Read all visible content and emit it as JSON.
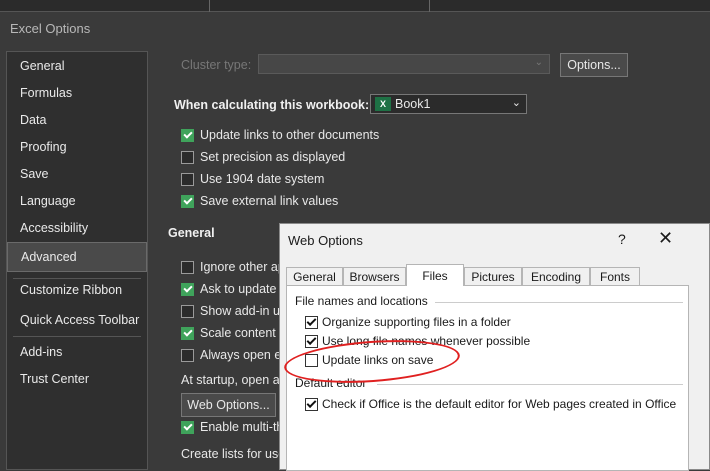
{
  "window": {
    "title": "Excel Options"
  },
  "sidebar": {
    "items": [
      {
        "label": "General"
      },
      {
        "label": "Formulas"
      },
      {
        "label": "Data"
      },
      {
        "label": "Proofing"
      },
      {
        "label": "Save"
      },
      {
        "label": "Language"
      },
      {
        "label": "Accessibility"
      },
      {
        "label": "Advanced",
        "active": true
      },
      {
        "label": "Customize Ribbon"
      },
      {
        "label": "Quick Access Toolbar"
      },
      {
        "label": "Add-ins"
      },
      {
        "label": "Trust Center"
      }
    ]
  },
  "main": {
    "cluster_type_label": "Cluster type:",
    "options_button": "Options...",
    "calc_heading": "When calculating this workbook:",
    "workbook_select": "Book1",
    "calc_options": [
      {
        "label": "Update links to other documents",
        "checked": true
      },
      {
        "label": "Set precision as displayed",
        "checked": false
      },
      {
        "label": "Use 1904 date system",
        "checked": false
      },
      {
        "label": "Save external link values",
        "checked": true
      }
    ],
    "general_heading": "General",
    "general_options": [
      {
        "label": "Ignore other ap",
        "checked": false
      },
      {
        "label": "Ask to update a",
        "checked": true
      },
      {
        "label": "Show add-in us",
        "checked": false
      },
      {
        "label": "Scale content f",
        "checked": true
      },
      {
        "label": "Always open er",
        "checked": false
      }
    ],
    "startup_label": "At startup, open al",
    "web_options_button": "Web Options...",
    "multithread_label": "Enable multi-th",
    "multithread_checked": true,
    "create_lists_label": "Create lists for use"
  },
  "dialog": {
    "title": "Web Options",
    "help": "?",
    "close": "✕",
    "tabs": [
      {
        "label": "General"
      },
      {
        "label": "Browsers"
      },
      {
        "label": "Files",
        "active": true
      },
      {
        "label": "Pictures"
      },
      {
        "label": "Encoding"
      },
      {
        "label": "Fonts"
      }
    ],
    "file_names_group": "File names and locations",
    "file_options": [
      {
        "label": "Organize supporting files in a folder",
        "checked": true
      },
      {
        "label": "Use long file names whenever possible",
        "checked": true
      },
      {
        "label": "Update links on save",
        "checked": false
      }
    ],
    "default_editor_group": "Default editor",
    "editor_option": {
      "label": "Check if Office is the default editor for Web pages created in Office",
      "checked": true
    }
  },
  "colors": {
    "accent_check": "#3fa35b",
    "annotation": "#e02020",
    "excel_green": "#1e7145"
  }
}
